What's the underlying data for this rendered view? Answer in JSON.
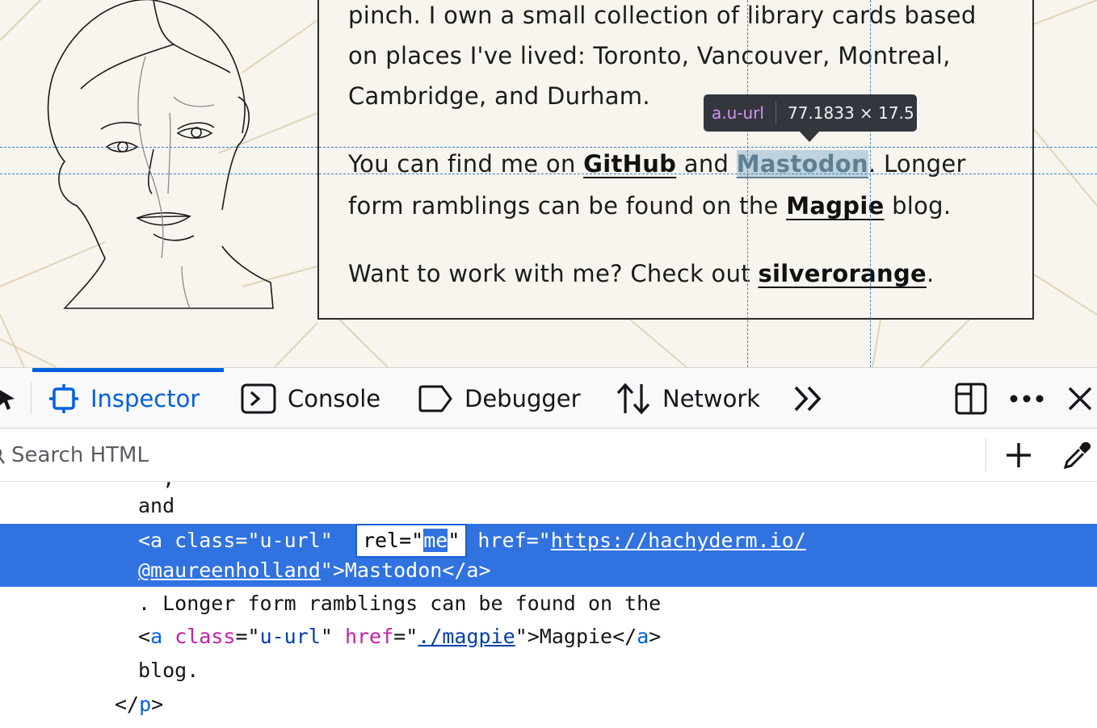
{
  "page": {
    "bio_line1": "pinch. I own a small collection of library cards based",
    "bio_line2": "on places I've lived: Toronto, Vancouver, Montreal,",
    "bio_line3": "Cambridge, and Durham.",
    "p2_prefix": "You can find me on ",
    "github_link": "GitHub",
    "p2_and": " and ",
    "mastodon_link": "Mastodon",
    "p2_suffix": ". Longer",
    "p2_line2_prefix": "form ramblings can be found on the ",
    "magpie_link": "Magpie",
    "p2_line2_suffix": " blog.",
    "p3_prefix": "Want to work with me? Check out ",
    "silverorange_link": "silverorange",
    "p3_suffix": "."
  },
  "tooltip": {
    "selector": "a.u-url",
    "dimensions": "77.1833 × 17.5"
  },
  "devtools": {
    "tabs": [
      {
        "label": "Inspector",
        "icon": "inspector-icon",
        "active": true
      },
      {
        "label": "Console",
        "icon": "console-icon",
        "active": false
      },
      {
        "label": "Debugger",
        "icon": "debugger-icon",
        "active": false
      },
      {
        "label": "Network",
        "icon": "network-icon",
        "active": false
      }
    ],
    "search_placeholder": "Search HTML",
    "accent": "#0060df",
    "selection_color": "#3072e0"
  },
  "markup": {
    "and_text": "and",
    "sel_open": "<a class=\"u-url\" ",
    "sel_attr_name": "rel=\"",
    "sel_attr_value": "me",
    "sel_attr_close": "\"",
    "sel_href_label": " href=\"",
    "sel_href_part1": "https://hachyderm.io/",
    "sel_href_part2": "@maureenholland",
    "sel_tail": "\">Mastodon</a>",
    "text_line": ". Longer form ramblings can be found on the",
    "magpie_lt": "<",
    "magpie_tag": "a",
    "magpie_attr": "class",
    "magpie_eq": "=\"",
    "magpie_class_val": "u-url",
    "magpie_q": "\" ",
    "magpie_href_attr": "href",
    "magpie_href_val": "./magpie",
    "magpie_close": "\">Magpie</",
    "magpie_end_gt": ">",
    "blog_text": "blog.",
    "p_close_lt": "</",
    "p_tag": "p",
    "p_close_gt": ">"
  }
}
